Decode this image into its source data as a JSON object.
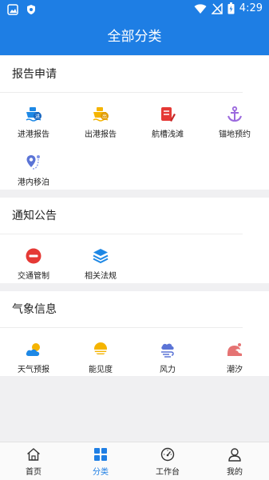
{
  "status_bar": {
    "time": "4:29"
  },
  "header": {
    "title": "全部分类"
  },
  "sections": [
    {
      "title": "报告申请",
      "items": [
        {
          "label": "进港报告",
          "icon": "ship-in-icon",
          "color": "#1e88e5"
        },
        {
          "label": "出港报告",
          "icon": "ship-out-icon",
          "color": "#f5b400"
        },
        {
          "label": "航槽浅滩",
          "icon": "document-edit-icon",
          "color": "#e53935"
        },
        {
          "label": "锚地预约",
          "icon": "anchor-icon",
          "color": "#9c6ade"
        },
        {
          "label": "港内移泊",
          "icon": "location-route-icon",
          "color": "#5b74d6"
        }
      ]
    },
    {
      "title": "通知公告",
      "items": [
        {
          "label": "交通管制",
          "icon": "no-entry-icon",
          "color": "#e53935"
        },
        {
          "label": "相关法规",
          "icon": "layers-icon",
          "color": "#1e88e5"
        }
      ]
    },
    {
      "title": "气象信息",
      "items": [
        {
          "label": "天气预报",
          "icon": "cloud-sun-icon",
          "color": "#1e88e5"
        },
        {
          "label": "能见度",
          "icon": "sun-fog-icon",
          "color": "#f5b400"
        },
        {
          "label": "风力",
          "icon": "cloud-wind-icon",
          "color": "#5b74d6"
        },
        {
          "label": "潮汐",
          "icon": "tide-icon",
          "color": "#e57373"
        }
      ]
    }
  ],
  "bottom_nav": [
    {
      "label": "首页",
      "icon": "home-icon",
      "active": false
    },
    {
      "label": "分类",
      "icon": "grid-icon",
      "active": true
    },
    {
      "label": "工作台",
      "icon": "dashboard-icon",
      "active": false
    },
    {
      "label": "我的",
      "icon": "user-icon",
      "active": false
    }
  ],
  "colors": {
    "primary": "#1e7ee4",
    "background": "#f0f0f2"
  }
}
